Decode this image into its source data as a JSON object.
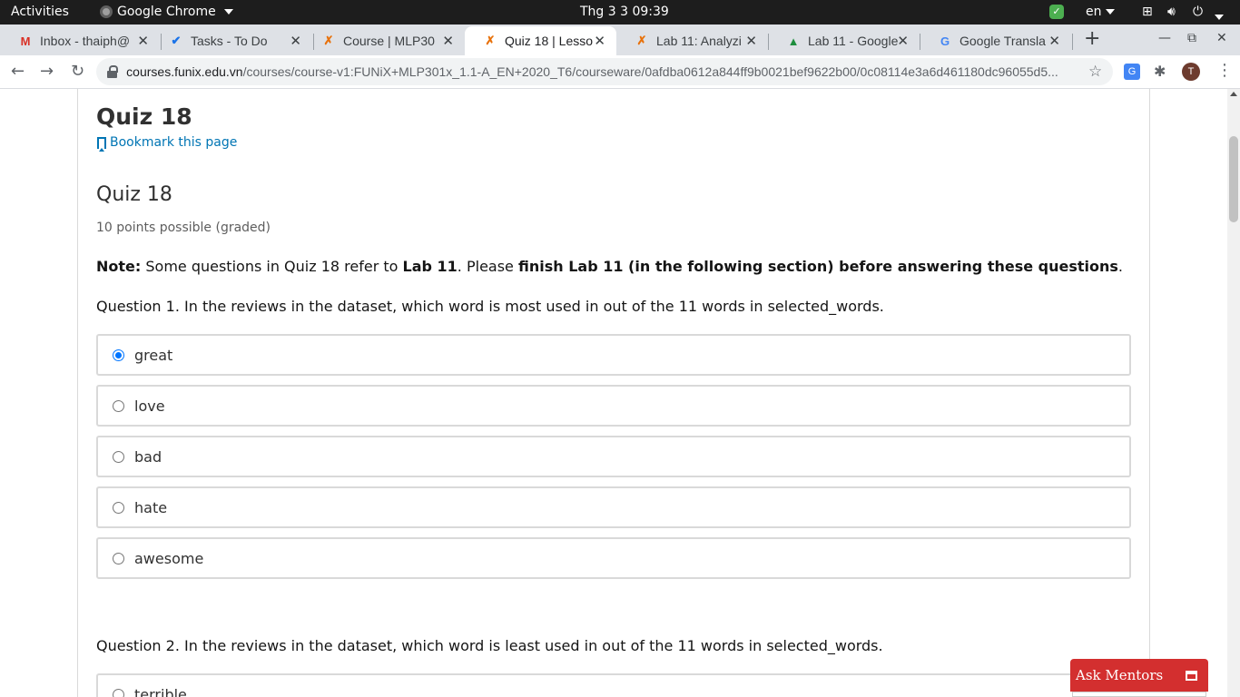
{
  "topbar": {
    "activities": "Activities",
    "app_name": "Google Chrome",
    "clock": "Thg 3 3  09:39",
    "lang": "en"
  },
  "tabs": [
    {
      "title": "Inbox - thaiph@",
      "icon": "gmail-icon",
      "active": false
    },
    {
      "title": "Tasks - To Do",
      "icon": "check-icon",
      "active": false
    },
    {
      "title": "Course | MLP30",
      "icon": "funix-icon",
      "active": false
    },
    {
      "title": "Quiz 18 | Lesso",
      "icon": "funix-icon",
      "active": true
    },
    {
      "title": "Lab 11: Analyzi",
      "icon": "funix-icon",
      "active": false
    },
    {
      "title": "Lab 11 - Google",
      "icon": "drive-icon",
      "active": false
    },
    {
      "title": "Google Transla",
      "icon": "translate-icon",
      "active": false
    }
  ],
  "omnibox": {
    "host": "courses.funix.edu.vn",
    "path": "/courses/course-v1:FUNiX+MLP301x_1.1-A_EN+2020_T6/courseware/0afdba0612a844ff9b0021bef9622b00/0c08114e3a6d461180dc96055d5..."
  },
  "profile": {
    "initial": "T"
  },
  "page": {
    "unit_title": "Quiz 18",
    "bookmark": "Bookmark this page",
    "problem_title": "Quiz 18",
    "points": "10 points possible (graded)",
    "note": {
      "label": "Note:",
      "text1": " Some questions in Quiz 18 refer to ",
      "lab": "Lab 11",
      "text2": ". Please ",
      "emph": "finish Lab 11 (in the following section) before answering these questions",
      "text3": "."
    },
    "question1": "Question 1. In the reviews in the dataset, which word is most used in out of the 11 words in selected_words.",
    "choices": [
      {
        "label": "great",
        "checked": true
      },
      {
        "label": "love",
        "checked": false
      },
      {
        "label": "bad",
        "checked": false
      },
      {
        "label": "hate",
        "checked": false
      },
      {
        "label": "awesome",
        "checked": false
      }
    ],
    "question2": "Question 2. In the reviews in the dataset, which word is least used in out of the 11 words in selected_words.",
    "q2_first_choice": "terrible"
  },
  "widget": {
    "ask_mentors": "Ask Mentors"
  },
  "colors": {
    "accent": "#0075b4",
    "radio": "#0075ff",
    "mentor_red": "#d32f2f"
  }
}
